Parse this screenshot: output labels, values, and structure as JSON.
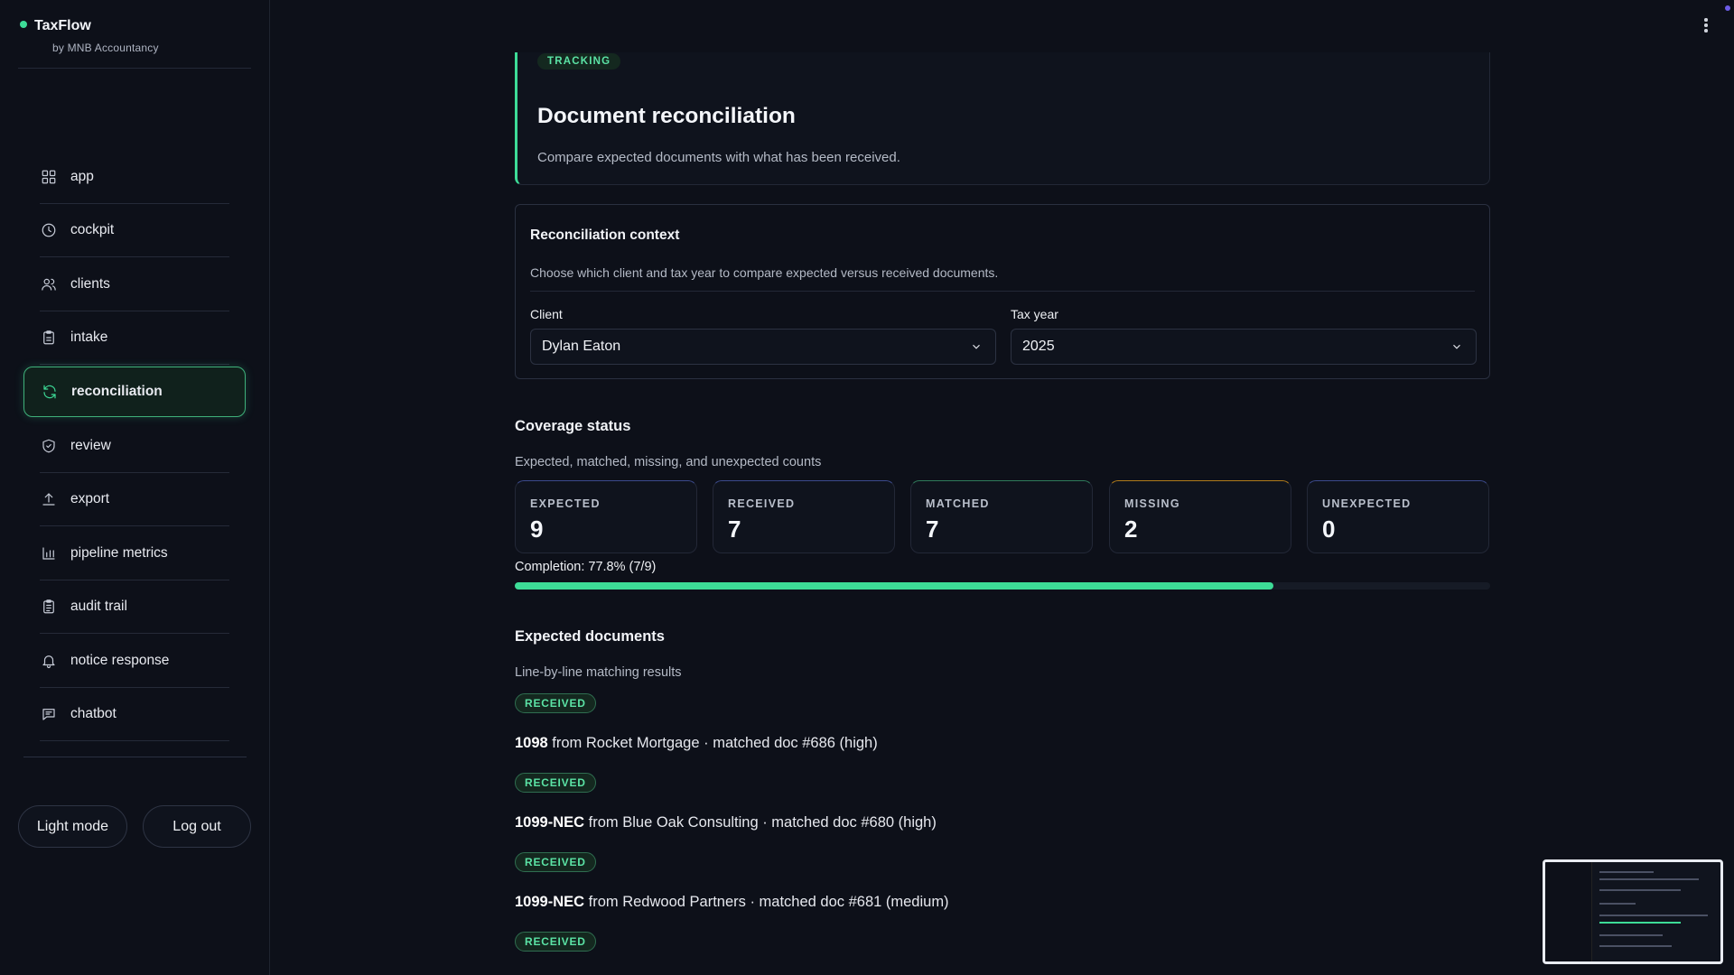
{
  "brand": {
    "name": "TaxFlow",
    "subtitle": "by MNB Accountancy"
  },
  "sidebar": {
    "items": [
      {
        "label": "app",
        "icon": "grid-icon"
      },
      {
        "label": "cockpit",
        "icon": "clock-icon"
      },
      {
        "label": "clients",
        "icon": "users-icon"
      },
      {
        "label": "intake",
        "icon": "clipboard-icon"
      },
      {
        "label": "reconciliation",
        "icon": "refresh-icon",
        "active": true
      },
      {
        "label": "review",
        "icon": "shield-check-icon"
      },
      {
        "label": "export",
        "icon": "upload-icon"
      },
      {
        "label": "pipeline metrics",
        "icon": "bar-chart-icon"
      },
      {
        "label": "audit trail",
        "icon": "clipboard-list-icon"
      },
      {
        "label": "notice response",
        "icon": "bell-icon"
      },
      {
        "label": "chatbot",
        "icon": "message-icon"
      }
    ],
    "light_mode_label": "Light mode",
    "logout_label": "Log out"
  },
  "header": {
    "badge": "TRACKING",
    "title": "Document reconciliation",
    "subtitle": "Compare expected documents with what has been received."
  },
  "context": {
    "title": "Reconciliation context",
    "subtitle": "Choose which client and tax year to compare expected versus received documents.",
    "client_label": "Client",
    "client_value": "Dylan Eaton",
    "year_label": "Tax year",
    "year_value": "2025"
  },
  "coverage": {
    "title": "Coverage status",
    "subtitle": "Expected, matched, missing, and unexpected counts",
    "stats": [
      {
        "label": "EXPECTED",
        "value": "9",
        "accent": "#3b4a8c"
      },
      {
        "label": "RECEIVED",
        "value": "7",
        "accent": "#3b4a8c"
      },
      {
        "label": "MATCHED",
        "value": "7",
        "accent": "#2f7a5a"
      },
      {
        "label": "MISSING",
        "value": "2",
        "accent": "#b07a1a"
      },
      {
        "label": "UNEXPECTED",
        "value": "0",
        "accent": "#3b4a8c"
      }
    ],
    "completion_text": "Completion: 77.8% (7/9)",
    "completion_fraction": 0.778
  },
  "expected_docs": {
    "title": "Expected documents",
    "subtitle": "Line-by-line matching results",
    "items": [
      {
        "status": "RECEIVED",
        "form": "1098",
        "detail": " from Rocket Mortgage · matched doc #686 (high)"
      },
      {
        "status": "RECEIVED",
        "form": "1099-NEC",
        "detail": " from Blue Oak Consulting · matched doc #680 (high)"
      },
      {
        "status": "RECEIVED",
        "form": "1099-NEC",
        "detail": " from Redwood Partners · matched doc #681 (medium)"
      },
      {
        "status": "RECEIVED"
      }
    ]
  },
  "colors": {
    "accent": "#3ddc97",
    "background": "#0d1019"
  }
}
